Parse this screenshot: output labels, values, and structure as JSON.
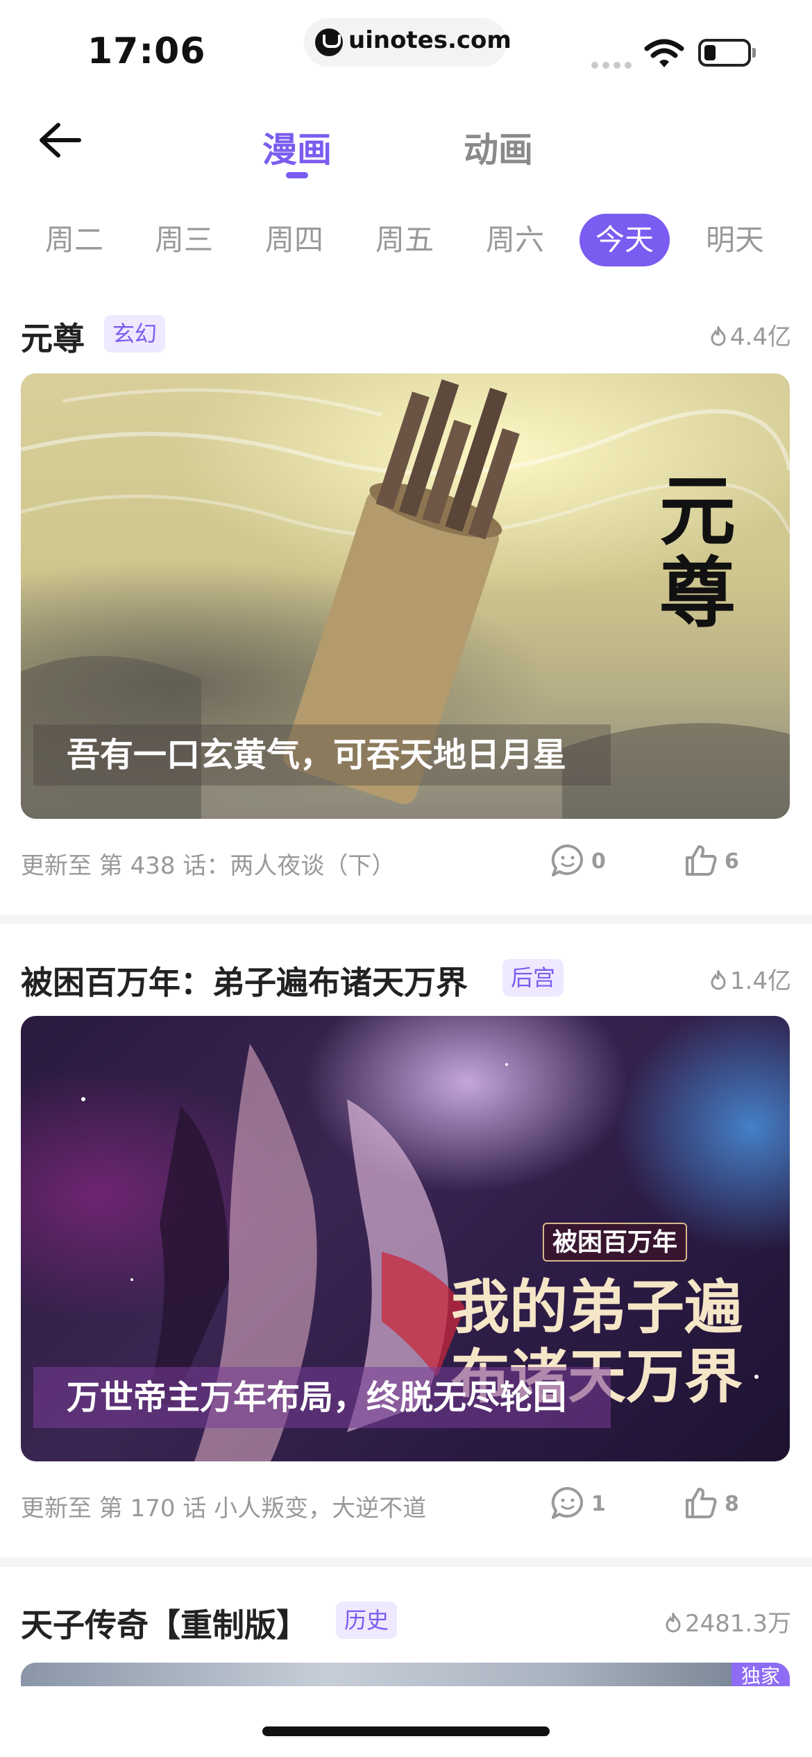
{
  "status_bar": {
    "time": "17:06",
    "url": "uinotes.com"
  },
  "header": {
    "tabs": [
      {
        "label": "漫画",
        "active": true
      },
      {
        "label": "动画",
        "active": false
      }
    ],
    "accent_color": "#7b5cf0"
  },
  "days": [
    {
      "label": "周二",
      "active": false
    },
    {
      "label": "周三",
      "active": false
    },
    {
      "label": "周四",
      "active": false
    },
    {
      "label": "周五",
      "active": false
    },
    {
      "label": "周六",
      "active": false
    },
    {
      "label": "今天",
      "active": true
    },
    {
      "label": "明天",
      "active": false
    }
  ],
  "items": [
    {
      "title": "元尊",
      "genre": "玄幻",
      "popularity": "4.4亿",
      "cover_caption": "吾有一口玄黄气，可吞天地日月星",
      "cover_art_text": "元尊",
      "update": "更新至 第 438 话：两人夜谈（下）",
      "comments": "0",
      "likes": "6"
    },
    {
      "title": "被困百万年：弟子遍布诸天万界",
      "genre": "后宫",
      "popularity": "1.4亿",
      "cover_caption": "万世帝主万年布局，终脱无尽轮回",
      "cover_art_subtitle": "被困百万年",
      "cover_art_text": "我的弟子遍布诸天万界",
      "update": "更新至 第 170 话 小人叛变，大逆不道",
      "comments": "1",
      "likes": "8"
    },
    {
      "title": "天子传奇【重制版】",
      "genre": "历史",
      "popularity": "2481.3万",
      "tag": "独家"
    }
  ]
}
